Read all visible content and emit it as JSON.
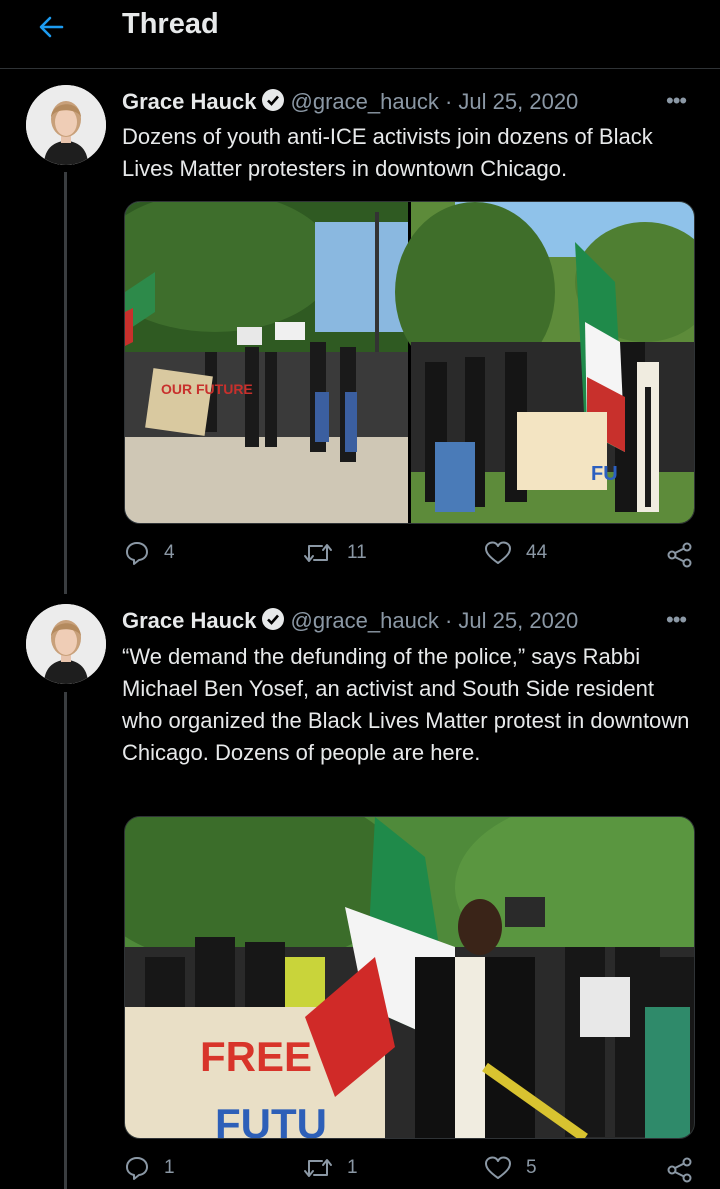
{
  "header": {
    "title": "Thread",
    "back_icon": "arrow-left-icon"
  },
  "tweets": [
    {
      "author": "Grace Hauck",
      "handle": "@grace_hauck",
      "sep": "·",
      "date": "Jul 25, 2020",
      "more": "•••",
      "text": "Dozens of youth anti-ICE activists join dozens of Black Lives Matter protesters in downtown Chicago.",
      "media": [
        "protest-march-photo",
        "protest-rally-photo"
      ],
      "photo_text": {
        "sign1": "OUR FUTURE",
        "sign2": "FU"
      },
      "replies": "4",
      "retweets": "11",
      "likes": "44"
    },
    {
      "author": "Grace Hauck",
      "handle": "@grace_hauck",
      "sep": "·",
      "date": "Jul 25, 2020",
      "more": "•••",
      "text": "“We demand the defunding of the police,” says Rabbi Michael Ben Yosef, an activist and South Side resident who organized the Black Lives Matter protest in downtown Chicago. Dozens of people are here.",
      "media": [
        "rabbi-speaking-photo"
      ],
      "photo_text": {
        "banner_line1": "FREE",
        "banner_line2": "FUTU"
      },
      "replies": "1",
      "retweets": "1",
      "likes": "5"
    }
  ],
  "colors": {
    "accent": "#1d9bf0",
    "muted": "#8b98a5",
    "text": "#e7e9ea",
    "background": "#000000"
  }
}
